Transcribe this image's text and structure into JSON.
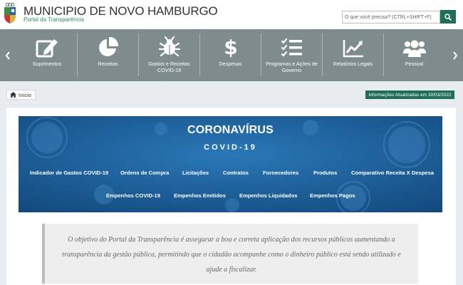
{
  "header": {
    "title": "MUNICIPIO DE NOVO HAMBURGO",
    "subtitle": "Portal da Transparência",
    "logo_icon": "municipal-crest-icon",
    "search": {
      "placeholder": "O que você precisa? (CTRL+SHIFT+F)",
      "button_icon": "search-icon"
    }
  },
  "nav": {
    "prev_icon": "chevron-left-icon",
    "next_icon": "chevron-right-icon",
    "items": [
      {
        "label": "Suprimentos",
        "icon": "edit-icon"
      },
      {
        "label": "Receitas",
        "icon": "pie-chart-icon"
      },
      {
        "label": "Gastos e Receitas COVID-19",
        "icon": "virus-icon"
      },
      {
        "label": "Despesas",
        "icon": "dollar-icon"
      },
      {
        "label": "Programas e Ações de Governo",
        "icon": "checklist-icon"
      },
      {
        "label": "Relatórios Legais",
        "icon": "line-chart-icon"
      },
      {
        "label": "Pessoal",
        "icon": "users-icon"
      }
    ]
  },
  "breadcrumb": {
    "home_label": "Início",
    "home_icon": "home-icon"
  },
  "updated_label": "Informações Atualizadas em 30/03/2022",
  "banner": {
    "title": "CORONAVÍRUS",
    "subtitle": "COVID-19",
    "links_row1": [
      "Indicador de Gastos COVID-19",
      "Ordens de Compra",
      "Licitações",
      "Contratos",
      "Fornecedores",
      "Produtos",
      "Comparativo Receita X Despesa"
    ],
    "links_row2": [
      "Empenhos COVID-19",
      "Empenhos Emitidos",
      "Empenhos Liquidados",
      "Empenhos Pagos"
    ]
  },
  "quote": {
    "text": "O objetivo do Portal da Transparência é assegurar a boa e correta aplicação dos recursos públicos aumentando a transparência da gestão pública, permitindo que o cidadão acompanhe como o dinheiro público está sendo utilizado e ajude a fiscalizar."
  },
  "colors": {
    "brand": "#1e6e58",
    "nav_bg": "#7f8c8d",
    "banner_bg": "#1b5f98"
  }
}
